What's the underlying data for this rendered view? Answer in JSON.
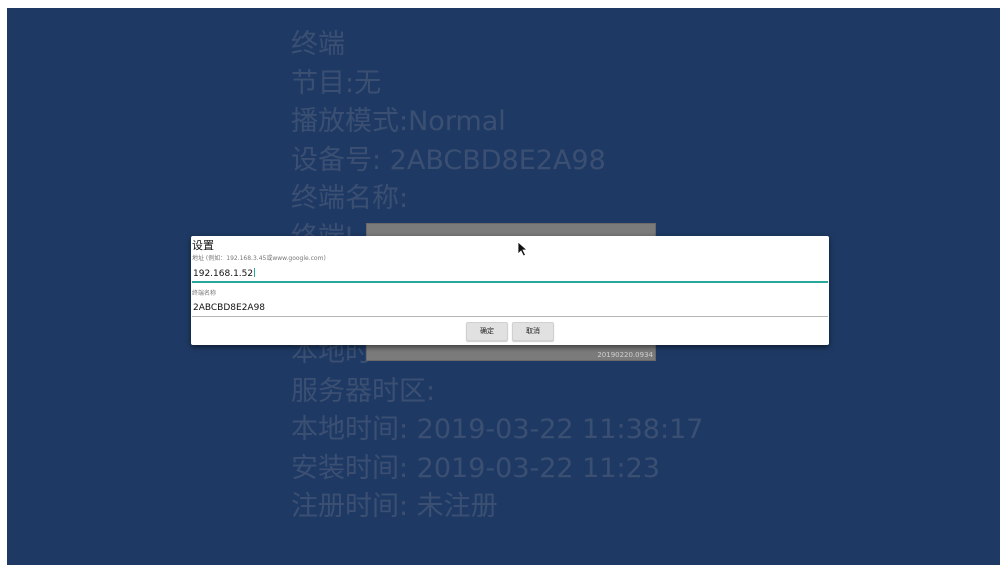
{
  "info": {
    "lines": [
      "终端",
      "节目:无",
      "播放模式:Normal",
      "设备号: 2ABCBD8E2A98",
      "终端名称:",
      "终端I",
      "",
      "",
      "本地时",
      "服务器时区:",
      "本地时间: 2019-03-22 11:38:17",
      "安装时间: 2019-03-22 11:23",
      "注册时间: 未注册"
    ]
  },
  "background_panel": {
    "version": "20190220.0934"
  },
  "dialog": {
    "title": "设置",
    "address": {
      "label": "地址 (例如：192.168.3.45或www.google.com)",
      "value": "192.168.1.52"
    },
    "terminal_name": {
      "label": "终端名称",
      "value": "2ABCBD8E2A98"
    },
    "confirm_label": "确定",
    "cancel_label": "取消"
  },
  "colors": {
    "background": "#1e3a64",
    "info_text": "#3b4f72",
    "accent": "#2aa79b"
  },
  "icons": {
    "mouse": "mouse-pointer-icon"
  }
}
